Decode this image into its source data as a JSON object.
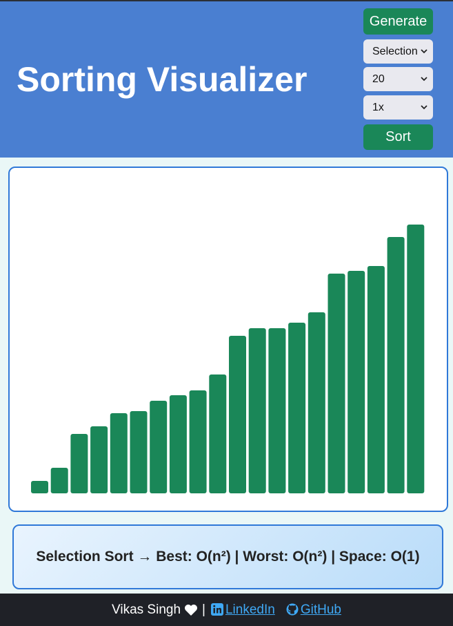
{
  "header": {
    "title": "Sorting Visualizer",
    "generate_label": "Generate",
    "algorithm_select": "Selection",
    "size_select": "20",
    "speed_select": "1x",
    "sort_label": "Sort"
  },
  "complexity": {
    "text": "Selection Sort → Best: O(n²) | Worst: O(n²) | Space: O(1)"
  },
  "footer": {
    "author": "Vikas Singh",
    "separator": "|",
    "linkedin": "LinkedIn",
    "github": "GitHub"
  },
  "colors": {
    "header_bg": "#4a7fd1",
    "button_bg": "#1a8758",
    "bar": "#1a8758",
    "border": "#2f78d8",
    "footer_bg": "#1f2127",
    "link": "#3fa9f5"
  },
  "chart_data": {
    "type": "bar",
    "values": [
      18,
      37,
      86,
      97,
      116,
      119,
      134,
      142,
      149,
      172,
      228,
      239,
      239,
      247,
      262,
      318,
      322,
      329,
      371,
      389
    ],
    "ylim": [
      0,
      470
    ]
  }
}
